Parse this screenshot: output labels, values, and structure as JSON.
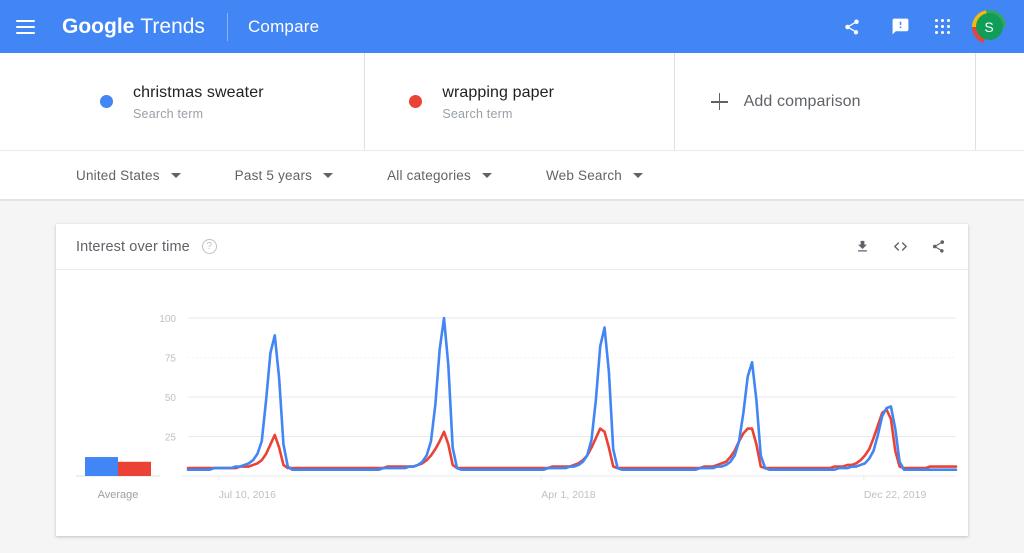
{
  "appbar": {
    "menu_icon": "hamburger-menu-icon",
    "brand_primary": "Google",
    "brand_secondary": "Trends",
    "section": "Compare",
    "icons": [
      {
        "name": "share-icon",
        "label": "Share"
      },
      {
        "name": "feedback-icon",
        "label": "Send feedback"
      },
      {
        "name": "google-apps-icon",
        "label": "Google apps"
      }
    ],
    "avatar_initial": "S",
    "bar_color": "#4285f4"
  },
  "compare": {
    "terms": [
      {
        "title": "christmas sweater",
        "subtitle": "Search term",
        "color": "#4285f4"
      },
      {
        "title": "wrapping paper",
        "subtitle": "Search term",
        "color": "#ea4335"
      }
    ],
    "add_label": "Add comparison",
    "add_icon": "plus-icon"
  },
  "filters": [
    {
      "name": "location",
      "label": "United States"
    },
    {
      "name": "time-range",
      "label": "Past 5 years"
    },
    {
      "name": "category",
      "label": "All categories"
    },
    {
      "name": "search-type",
      "label": "Web Search"
    }
  ],
  "card": {
    "title": "Interest over time",
    "help_icon": "help-icon",
    "help_glyph": "?",
    "actions": [
      {
        "name": "download-csv-icon",
        "label": "Download"
      },
      {
        "name": "embed-code-icon",
        "label": "Embed"
      },
      {
        "name": "share-chart-icon",
        "label": "Share"
      }
    ]
  },
  "chart_data": {
    "type": "line",
    "title": "Interest over time",
    "xlabel": "",
    "ylabel": "",
    "ylim": [
      0,
      100
    ],
    "yticks": [
      25,
      50,
      75,
      100
    ],
    "ytick_labels": [
      "25",
      "50",
      "75",
      "100"
    ],
    "xtick_labels": [
      "Jul 10, 2016",
      "Apr 1, 2018",
      "Dec 22, 2019"
    ],
    "xtick_positions": [
      0.04,
      0.46,
      0.88
    ],
    "grid": true,
    "legend": "none",
    "average_label": "Average",
    "averages": [
      12,
      9
    ],
    "series": [
      {
        "name": "christmas sweater",
        "color": "#4285f4",
        "values": [
          4,
          4,
          4,
          4,
          4,
          4,
          5,
          5,
          5,
          5,
          5,
          6,
          6,
          7,
          8,
          10,
          14,
          22,
          48,
          78,
          89,
          62,
          20,
          6,
          4,
          4,
          4,
          4,
          4,
          4,
          4,
          4,
          4,
          4,
          4,
          4,
          4,
          4,
          4,
          4,
          4,
          4,
          4,
          4,
          4,
          5,
          5,
          5,
          5,
          5,
          5,
          6,
          6,
          7,
          9,
          13,
          22,
          45,
          80,
          100,
          70,
          18,
          5,
          4,
          4,
          4,
          4,
          4,
          4,
          4,
          4,
          4,
          4,
          4,
          4,
          4,
          4,
          4,
          4,
          4,
          4,
          4,
          4,
          5,
          5,
          5,
          5,
          5,
          6,
          6,
          7,
          9,
          13,
          23,
          48,
          82,
          94,
          66,
          17,
          5,
          4,
          4,
          4,
          4,
          4,
          4,
          4,
          4,
          4,
          4,
          4,
          4,
          4,
          4,
          4,
          4,
          4,
          4,
          5,
          5,
          5,
          5,
          6,
          6,
          7,
          9,
          13,
          22,
          40,
          63,
          72,
          48,
          13,
          5,
          4,
          4,
          4,
          4,
          4,
          4,
          4,
          4,
          4,
          4,
          4,
          4,
          4,
          4,
          4,
          4,
          5,
          5,
          5,
          6,
          6,
          7,
          8,
          11,
          16,
          26,
          38,
          43,
          44,
          30,
          9,
          4,
          4,
          4,
          4,
          4,
          4,
          4,
          4,
          4,
          4,
          4,
          4,
          4
        ]
      },
      {
        "name": "wrapping paper",
        "color": "#ea4335",
        "values": [
          5,
          5,
          5,
          5,
          5,
          5,
          5,
          5,
          5,
          5,
          5,
          5,
          6,
          6,
          6,
          7,
          8,
          10,
          14,
          20,
          26,
          18,
          7,
          5,
          5,
          5,
          5,
          5,
          5,
          5,
          5,
          5,
          5,
          5,
          5,
          5,
          5,
          5,
          5,
          5,
          5,
          5,
          5,
          5,
          5,
          5,
          6,
          6,
          6,
          6,
          6,
          6,
          6,
          7,
          8,
          10,
          13,
          17,
          22,
          28,
          20,
          7,
          5,
          5,
          5,
          5,
          5,
          5,
          5,
          5,
          5,
          5,
          5,
          5,
          5,
          5,
          5,
          5,
          5,
          5,
          5,
          5,
          5,
          5,
          6,
          6,
          6,
          6,
          6,
          7,
          8,
          10,
          13,
          18,
          24,
          30,
          28,
          18,
          6,
          5,
          5,
          5,
          5,
          5,
          5,
          5,
          5,
          5,
          5,
          5,
          5,
          5,
          5,
          5,
          5,
          5,
          5,
          5,
          5,
          6,
          6,
          6,
          7,
          8,
          9,
          12,
          16,
          22,
          27,
          30,
          30,
          20,
          6,
          5,
          5,
          5,
          5,
          5,
          5,
          5,
          5,
          5,
          5,
          5,
          5,
          5,
          5,
          5,
          5,
          6,
          6,
          6,
          7,
          7,
          8,
          10,
          13,
          17,
          24,
          32,
          40,
          42,
          36,
          16,
          6,
          5,
          5,
          5,
          5,
          5,
          5,
          6,
          6,
          6,
          6,
          6,
          6,
          6
        ]
      }
    ]
  }
}
